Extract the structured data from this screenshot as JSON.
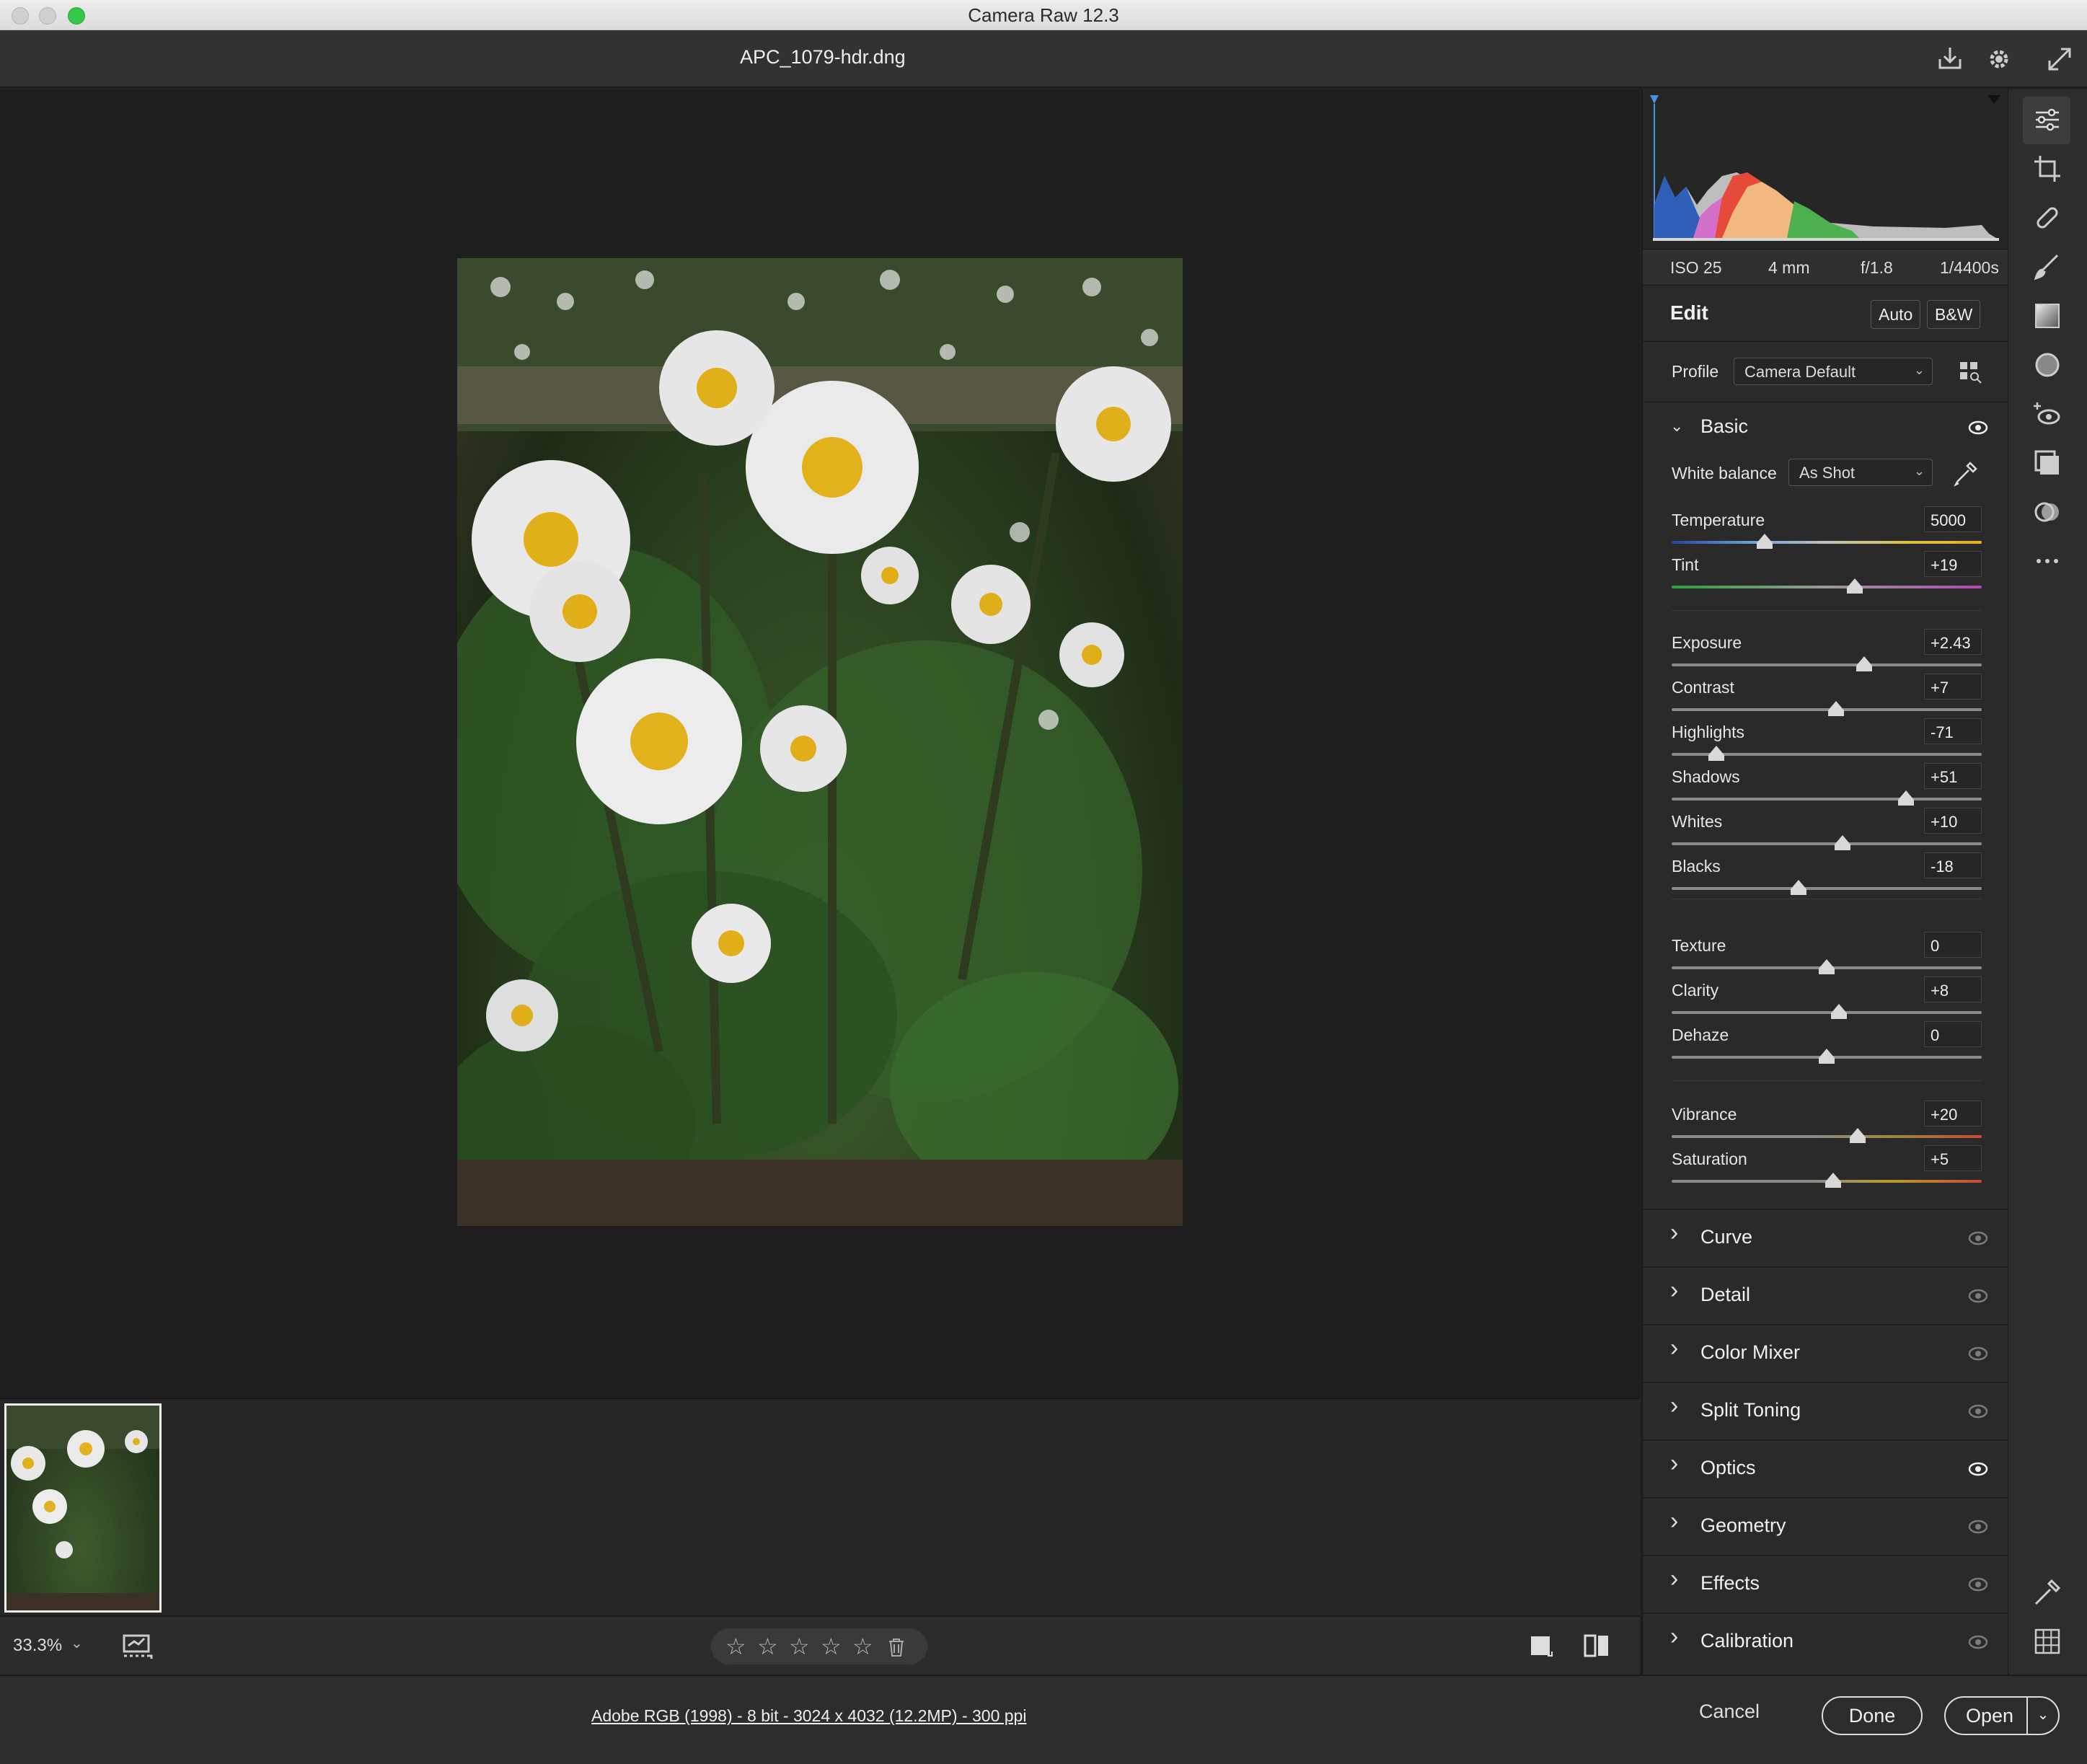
{
  "window": {
    "title": "Camera Raw 12.3"
  },
  "header": {
    "filename": "APC_1079-hdr.dng",
    "icons": [
      "save-icon",
      "settings-icon",
      "fullscreen-icon"
    ]
  },
  "exif": {
    "iso": "ISO 25",
    "focal": "4 mm",
    "aperture": "f/1.8",
    "shutter": "1/4400s"
  },
  "edit": {
    "title": "Edit",
    "auto": "Auto",
    "bw": "B&W"
  },
  "profile": {
    "label": "Profile",
    "value": "Camera Default"
  },
  "basic": {
    "title": "Basic",
    "white_balance": {
      "label": "White balance",
      "value": "As Shot"
    },
    "sliders": [
      {
        "label": "Temperature",
        "value": "5000",
        "pos": 0.3
      },
      {
        "label": "Tint",
        "value": "+19",
        "pos": 0.59
      },
      {
        "label": "Exposure",
        "value": "+2.43",
        "pos": 0.62
      },
      {
        "label": "Contrast",
        "value": "+7",
        "pos": 0.53
      },
      {
        "label": "Highlights",
        "value": "-71",
        "pos": 0.145
      },
      {
        "label": "Shadows",
        "value": "+51",
        "pos": 0.755
      },
      {
        "label": "Whites",
        "value": "+10",
        "pos": 0.55
      },
      {
        "label": "Blacks",
        "value": "-18",
        "pos": 0.41
      },
      {
        "label": "Texture",
        "value": "0",
        "pos": 0.5
      },
      {
        "label": "Clarity",
        "value": "+8",
        "pos": 0.54
      },
      {
        "label": "Dehaze",
        "value": "0",
        "pos": 0.5
      },
      {
        "label": "Vibrance",
        "value": "+20",
        "pos": 0.6
      },
      {
        "label": "Saturation",
        "value": "+5",
        "pos": 0.52
      }
    ]
  },
  "sections": [
    {
      "title": "Curve",
      "visible": false
    },
    {
      "title": "Detail",
      "visible": false
    },
    {
      "title": "Color Mixer",
      "visible": false
    },
    {
      "title": "Split Toning",
      "visible": false
    },
    {
      "title": "Optics",
      "visible": true
    },
    {
      "title": "Geometry",
      "visible": false
    },
    {
      "title": "Effects",
      "visible": false
    },
    {
      "title": "Calibration",
      "visible": false
    }
  ],
  "bottombar": {
    "zoom": "33.3%",
    "stars": [
      "☆",
      "☆",
      "☆",
      "☆",
      "☆"
    ]
  },
  "footer": {
    "info": "Adobe RGB (1998) - 8 bit - 3024 x 4032 (12.2MP) - 300 ppi",
    "cancel": "Cancel",
    "done": "Done",
    "open": "Open"
  },
  "tools": [
    "edit-sliders-icon",
    "crop-icon",
    "heal-icon",
    "brush-icon",
    "gradient-icon",
    "radial-filter-icon",
    "red-eye-icon",
    "snapshots-icon",
    "presets-icon",
    "more-icon"
  ]
}
